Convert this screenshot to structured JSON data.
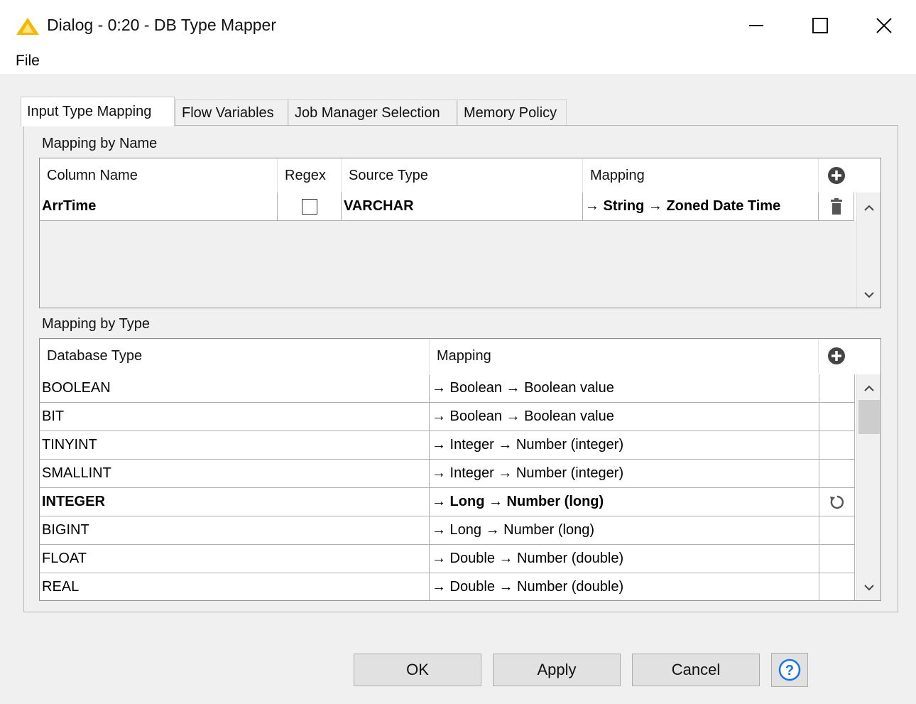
{
  "window": {
    "title": "Dialog - 0:20 - DB Type Mapper",
    "controls": {
      "minimize": "—",
      "maximize": "☐",
      "close": "✕"
    }
  },
  "menu": {
    "file": "File"
  },
  "tabs": [
    {
      "label": "Input Type Mapping",
      "active": true
    },
    {
      "label": "Flow Variables",
      "active": false
    },
    {
      "label": "Job Manager Selection",
      "active": false
    },
    {
      "label": "Memory Policy",
      "active": false
    }
  ],
  "mapping_by_name": {
    "title": "Mapping by Name",
    "headers": {
      "column_name": "Column Name",
      "regex": "Regex",
      "source_type": "Source Type",
      "mapping": "Mapping"
    },
    "rows": [
      {
        "column_name": "ArrTime",
        "regex": false,
        "source_type": "VARCHAR",
        "mapping": "→ String → Zoned Date Time",
        "bold": true
      }
    ]
  },
  "mapping_by_type": {
    "title": "Mapping by Type",
    "headers": {
      "database_type": "Database Type",
      "mapping": "Mapping"
    },
    "rows": [
      {
        "database_type": "BOOLEAN",
        "mapping": "→ Boolean → Boolean value",
        "bold": false
      },
      {
        "database_type": "BIT",
        "mapping": "→ Boolean → Boolean value",
        "bold": false
      },
      {
        "database_type": "TINYINT",
        "mapping": "→ Integer → Number (integer)",
        "bold": false
      },
      {
        "database_type": "SMALLINT",
        "mapping": "→ Integer → Number (integer)",
        "bold": false
      },
      {
        "database_type": "INTEGER",
        "mapping": "→ Long → Number (long)",
        "bold": true
      },
      {
        "database_type": "BIGINT",
        "mapping": "→ Long → Number (long)",
        "bold": false
      },
      {
        "database_type": "FLOAT",
        "mapping": "→ Double → Number (double)",
        "bold": false
      },
      {
        "database_type": "REAL",
        "mapping": "→ Double → Number (double)",
        "bold": false
      }
    ]
  },
  "buttons": {
    "ok": "OK",
    "apply": "Apply",
    "cancel": "Cancel",
    "help": "?"
  },
  "colors": {
    "icon_dark": "#444444",
    "help_blue": "#1a73e8",
    "warning_yellow": "#f5b800"
  }
}
